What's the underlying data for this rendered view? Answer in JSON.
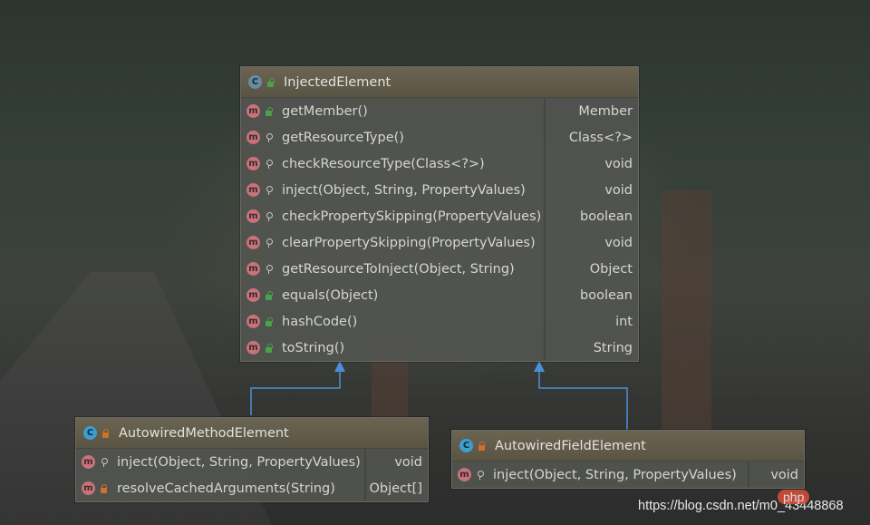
{
  "classes": {
    "injected": {
      "name": "InjectedElement",
      "kind_icon": "C",
      "methods": [
        {
          "sig": "getMember()",
          "ret": "Member",
          "vis": "public"
        },
        {
          "sig": "getResourceType()",
          "ret": "Class<?>",
          "vis": "package"
        },
        {
          "sig": "checkResourceType(Class<?>)",
          "ret": "void",
          "vis": "package"
        },
        {
          "sig": "inject(Object, String, PropertyValues)",
          "ret": "void",
          "vis": "package"
        },
        {
          "sig": "checkPropertySkipping(PropertyValues)",
          "ret": "boolean",
          "vis": "package"
        },
        {
          "sig": "clearPropertySkipping(PropertyValues)",
          "ret": "void",
          "vis": "package"
        },
        {
          "sig": "getResourceToInject(Object, String)",
          "ret": "Object",
          "vis": "package"
        },
        {
          "sig": "equals(Object)",
          "ret": "boolean",
          "vis": "public"
        },
        {
          "sig": "hashCode()",
          "ret": "int",
          "vis": "public"
        },
        {
          "sig": "toString()",
          "ret": "String",
          "vis": "public"
        }
      ]
    },
    "method_element": {
      "name": "AutowiredMethodElement",
      "kind_icon": "C",
      "methods": [
        {
          "sig": "inject(Object, String, PropertyValues)",
          "ret": "void",
          "vis": "package"
        },
        {
          "sig": "resolveCachedArguments(String)",
          "ret": "Object[]",
          "vis": "private"
        }
      ]
    },
    "field_element": {
      "name": "AutowiredFieldElement",
      "kind_icon": "C",
      "methods": [
        {
          "sig": "inject(Object, String, PropertyValues)",
          "ret": "void",
          "vis": "package"
        }
      ]
    }
  },
  "method_icon": "m",
  "icons": {
    "class": "class-icon",
    "abstract_class": "abstract-class-icon",
    "method": "method-icon",
    "public": "public-lock-icon",
    "package": "package-visibility-icon",
    "private": "private-lock-icon"
  },
  "colors": {
    "arrow": "#4a90d9",
    "header": "#5f5948",
    "body": "#525450",
    "method_icon": "#c6737a",
    "class_icon": "#3d9fd0"
  },
  "watermark": {
    "url": "https://blog.csdn.net/m0_43448868",
    "logo": "php"
  }
}
